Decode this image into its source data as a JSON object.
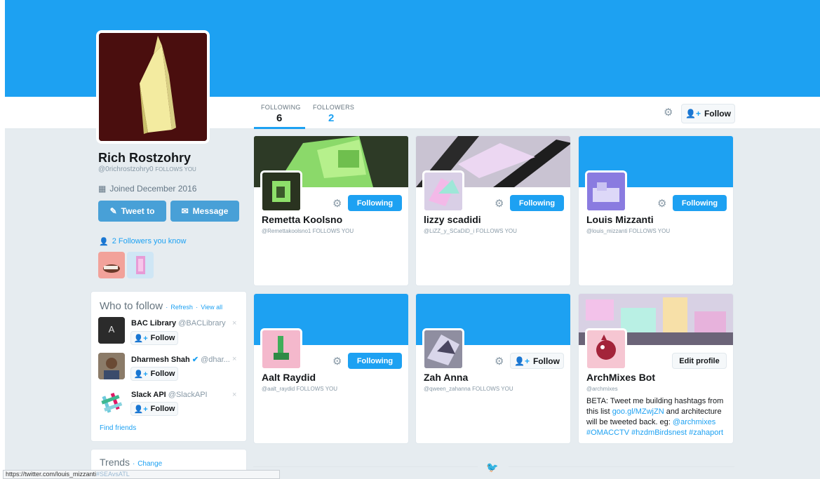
{
  "colors": {
    "brand": "#1da1f2",
    "banner": "#1da1f2",
    "background": "#e6ecf0"
  },
  "profile": {
    "name": "Rich Rostzohry",
    "handle": "@0richrostzohry0",
    "follows_you": "FOLLOWS YOU",
    "joined": "Joined December 2016",
    "tweet_to": "Tweet to",
    "message": "Message",
    "followers_you_know": "2 Followers you know"
  },
  "tabs": [
    {
      "label": "FOLLOWING",
      "count": "6"
    },
    {
      "label": "FOLLOWERS",
      "count": "2"
    }
  ],
  "header_follow": "Follow",
  "who_to_follow": {
    "title": "Who to follow",
    "refresh": "Refresh",
    "separator": "·",
    "view_all": "View all",
    "follow_label": "Follow",
    "close": "×",
    "items": [
      {
        "name": "BAC Library",
        "handle": "@BACLibrary"
      },
      {
        "name": "Dharmesh Shah",
        "handle": "@dhar..."
      },
      {
        "name": "Slack API",
        "handle": "@SlackAPI"
      }
    ],
    "find_friends": "Find friends"
  },
  "trends": {
    "title": "Trends",
    "change": "Change"
  },
  "cards": [
    {
      "name": "Remetta Koolsno",
      "handle": "@Remettakoolsno1",
      "follows_you": "FOLLOWS YOU",
      "button": "Following"
    },
    {
      "name": "lizzy scadidi",
      "handle": "@LiZZ_y_SCaDiD_i",
      "follows_you": "FOLLOWS YOU",
      "button": "Following"
    },
    {
      "name": "Louis Mizzanti",
      "handle": "@louis_mizzanti",
      "follows_you": "FOLLOWS YOU",
      "button": "Following"
    },
    {
      "name": "Aalt Raydid",
      "handle": "@aalt_raydid",
      "follows_you": "FOLLOWS YOU",
      "button": "Following"
    },
    {
      "name": "Zah Anna",
      "handle": "@qween_zahanna",
      "follows_you": "FOLLOWS YOU",
      "button": "Follow"
    },
    {
      "name": "ArchMixes Bot",
      "handle": "@archmixes",
      "follows_you": "",
      "button": "Edit profile",
      "bio": {
        "t1": "BETA: Tweet me building hashtags from this list ",
        "link": "goo.gl/MZwjZN",
        "t2": " and architecture will be tweeted back. eg: ",
        "mention": "@archmixes",
        "tags": "#OMACCTV #hzdmBirdsnest #zahaport"
      }
    }
  ],
  "status_bar": {
    "url": "https://twitter.com/louis_mizzanti",
    "trailing": "#SEAvsATL"
  }
}
